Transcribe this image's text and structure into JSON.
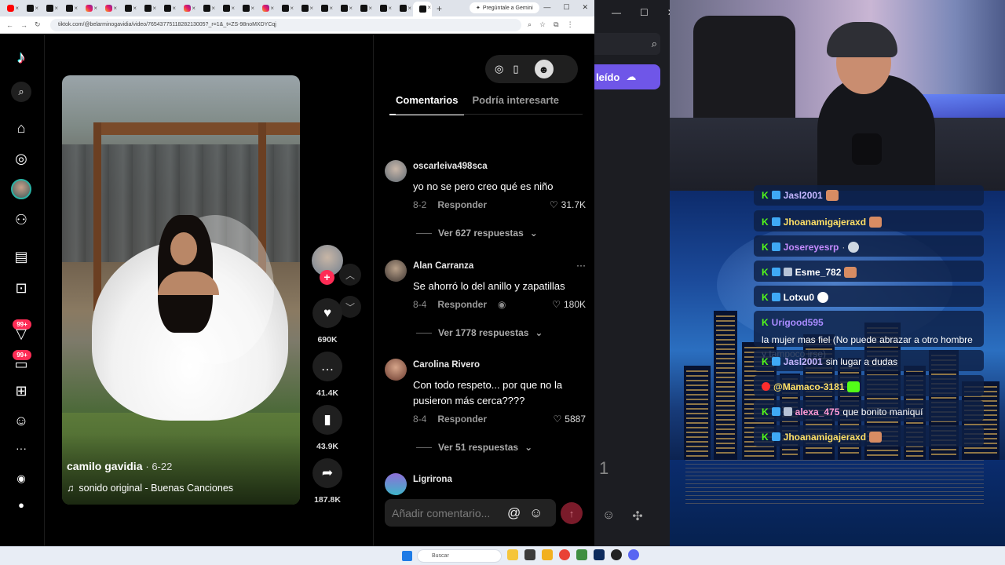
{
  "browser": {
    "gemini_tab": "Pregúntale a Gemini",
    "url": "tiktok.com/@belarminogavidia/video/7654377511828213005?_r=1&_t=ZS-98noMXDYCqj"
  },
  "video": {
    "author": "camilo gavidia",
    "date": "· 6-22",
    "sound": "sonido original - Buenas Canciones"
  },
  "actions": {
    "likes": "690K",
    "comments": "41.4K",
    "saves": "43.9K",
    "shares": "187.8K"
  },
  "sidebar": {
    "badge_1": "99+",
    "badge_2": "99+",
    "more": "···"
  },
  "panel": {
    "tabs": [
      "Comentarios",
      "Podría interesarte"
    ],
    "input_placeholder": "Añadir comentario...",
    "reply_label": "Responder",
    "comments": [
      {
        "user": "oscarleiva498sca",
        "text": "yo no se pero creo qué es niño",
        "date": "8-2",
        "likes": "31.7K",
        "more": "Ver 627 respuestas"
      },
      {
        "user": "Alan Carranza",
        "text": "Se ahorró lo del anillo y zapatillas",
        "date": "8-4",
        "likes": "180K",
        "more": "Ver 1778 respuestas"
      },
      {
        "user": "Carolina Rivero",
        "text": "Con todo respeto... por que no la pusieron más cerca????",
        "date": "8-4",
        "likes": "5887",
        "more": "Ver 51 respuestas"
      },
      {
        "user": "Ligrirona"
      }
    ]
  },
  "side_window": {
    "purple_label": "leído",
    "number": "1"
  },
  "stream_chat": [
    {
      "user": "Jasl2001",
      "text": ""
    },
    {
      "user": "Jhoanamigajeraxd",
      "text": ""
    },
    {
      "user": "Josereyesrp",
      "text": ""
    },
    {
      "user": "Esme_782",
      "text": ""
    },
    {
      "user": "Lotxu0",
      "text": ""
    },
    {
      "user": "Urigood595",
      "text": "la mujer mas fiel (No puede abrazar a otro hombre y tampoco irse)"
    },
    {
      "user": "Jasl2001",
      "text": "sin lugar a dudas"
    },
    {
      "user": "@Mamaco-3181",
      "text": ""
    },
    {
      "user": "alexa_475",
      "text": "que bonito maniquí"
    },
    {
      "user": "Jhoanamigajeraxd",
      "text": ""
    }
  ],
  "taskbar": {
    "search": "Buscar"
  },
  "colors": {
    "tiktok_red": "#fe2c55",
    "kick_green": "#53fc18",
    "purple": "#6f56e8"
  }
}
